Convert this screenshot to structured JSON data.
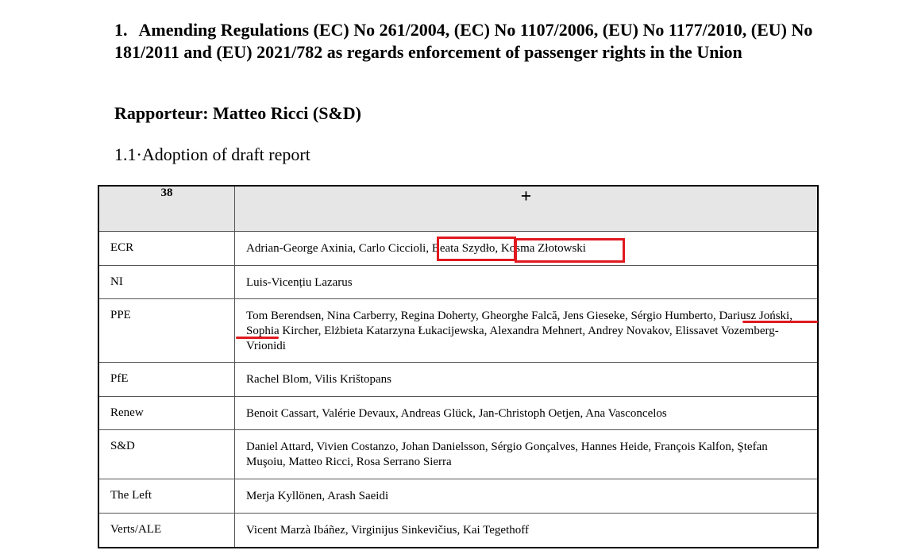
{
  "document": {
    "section_number": "1.",
    "section_title": "Amending Regulations (EC) No 261/2004, (EC) No 1107/2006, (EU) No 1177/2010, (EU) No 181/2011 and (EU) 2021/782 as regards enforcement of passenger rights in the Union",
    "rapporteur": "Rapporteur: Matteo Ricci (S&D)",
    "subsection": "1.1·Adoption of draft report"
  },
  "vote_table": {
    "count": "38",
    "sign": "+",
    "rows": [
      {
        "group": "ECR",
        "members": "Adrian-George Axinia, Carlo Ciccioli, Beata Szydło, Kosma Złotowski"
      },
      {
        "group": "NI",
        "members": "Luis-Vicențiu Lazarus"
      },
      {
        "group": "PPE",
        "members": "Tom Berendsen, Nina Carberry, Regina Doherty, Gheorghe Falcă, Jens Gieseke, Sérgio Humberto, Dariusz Joński, Sophia Kircher, Elżbieta Katarzyna Łukacijewska, Alexandra Mehnert, Andrey Novakov, Elissavet Vozemberg-Vrionidi"
      },
      {
        "group": "PfE",
        "members": "Rachel Blom, Vilis Krištopans"
      },
      {
        "group": "Renew",
        "members": "Benoit Cassart, Valérie Devaux, Andreas Glück, Jan-Christoph Oetjen, Ana Vasconcelos"
      },
      {
        "group": "S&D",
        "members": "Daniel Attard, Vivien Costanzo, Johan Danielsson, Sérgio Gonçalves, Hannes Heide, François Kalfon, Ştefan Muşoiu, Matteo Ricci, Rosa Serrano Sierra"
      },
      {
        "group": "The Left",
        "members": "Merja Kyllönen, Arash Saeidi"
      },
      {
        "group": "Verts/ALE",
        "members": "Vicent Marzà Ibáñez, Virginijus Sinkevičius, Kai Tegethoff"
      }
    ]
  },
  "annotations": {
    "color": "#e0191f",
    "marks": [
      {
        "kind": "box",
        "target": "Beata Szydło"
      },
      {
        "kind": "box",
        "target": "Kosma Złotowski"
      },
      {
        "kind": "underline",
        "target": "Dariusz Joński"
      }
    ]
  }
}
